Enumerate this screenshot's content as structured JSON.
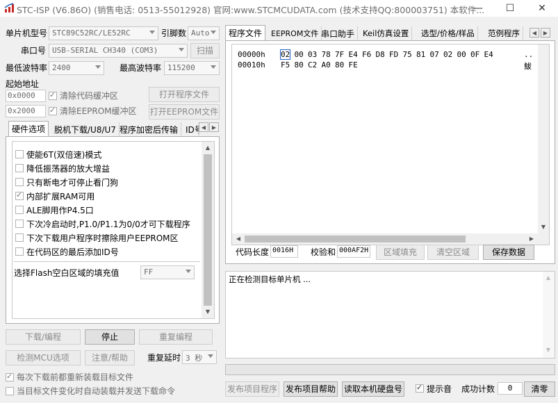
{
  "window": {
    "title": "STC-ISP (V6.86O) (销售电话: 0513-55012928) 官网:www.STCMCUDATA.com  (技术支持QQ:800003751) 本软件...",
    "min": "—",
    "max": "☐",
    "close": "✕"
  },
  "left": {
    "mcu_label": "单片机型号",
    "mcu_value": "STC89C52RC/LE52RC",
    "pins_label": "引脚数",
    "pins_value": "Auto",
    "port_label": "串口号",
    "port_value": "USB-SERIAL CH340 (COM3)",
    "scan": "扫描",
    "min_baud_label": "最低波特率",
    "min_baud_value": "2400",
    "max_baud_label": "最高波特率",
    "max_baud_value": "115200",
    "start_addr_label": "起始地址",
    "addr1": "0x0000",
    "clear_code": "清除代码缓冲区",
    "open_prog": "打开程序文件",
    "addr2": "0x2000",
    "clear_eeprom": "清除EEPROM缓冲区",
    "open_eeprom": "打开EEPROM文件",
    "tabs": [
      "硬件选项",
      "脱机下载/U8/U7",
      "程序加密后传输",
      "ID号"
    ],
    "options": [
      {
        "label": "使能6T(双倍速)模式",
        "checked": false
      },
      {
        "label": "降低振荡器的放大增益",
        "checked": false
      },
      {
        "label": "只有断电才可停止看门狗",
        "checked": false
      },
      {
        "label": "内部扩展RAM可用",
        "checked": true
      },
      {
        "label": "ALE脚用作P4.5口",
        "checked": false
      },
      {
        "label": "下次冷启动时,P1.0/P1.1为0/0才可下载程序",
        "checked": false
      },
      {
        "label": "下次下载用户程序时擦除用户EEPROM区",
        "checked": false
      },
      {
        "label": "在代码区的最后添加ID号",
        "checked": false
      }
    ],
    "flash_fill_label": "选择Flash空白区域的填充值",
    "flash_fill_value": "FF",
    "download": "下载/编程",
    "stop": "停止",
    "reprogram": "重复编程",
    "detect_mcu": "检测MCU选项",
    "help": "注意/帮助",
    "repeat_delay_label": "重复延时",
    "repeat_delay_value": "3 秒",
    "reload_each": "每次下载前都重新装载目标文件",
    "auto_reload": "当目标文件变化时自动装载并发送下载命令"
  },
  "right": {
    "tabs": [
      "程序文件",
      "EEPROM文件",
      "串口助手",
      "Keil仿真设置",
      "选型/价格/样品",
      "范例程序"
    ],
    "hex_rows": [
      {
        "addr": "00000h",
        "bytes": [
          "02",
          "00",
          "03",
          "78",
          "7F",
          "E4",
          "F6",
          "D8",
          "FD",
          "75",
          "81",
          "07",
          "02",
          "00",
          "0F",
          "E4"
        ],
        "ascii": ".."
      },
      {
        "addr": "00010h",
        "bytes": [
          "F5",
          "80",
          "C2",
          "A0",
          "80",
          "FE"
        ],
        "ascii": "鮁"
      }
    ],
    "code_len_label": "代码长度",
    "code_len_value": "0016H",
    "checksum_label": "校验和",
    "checksum_value": "000AF2H",
    "fill_area": "区域填充",
    "clear_area": "清空区域",
    "save_data": "保存数据",
    "log_text": "正在检测目标单片机 ...",
    "publish": "发布项目程序",
    "publish_help": "发布项目帮助",
    "read_hdd": "读取本机硬盘号",
    "sound_label": "提示音",
    "sound_checked": true,
    "success_count_label": "成功计数",
    "success_count_value": "0",
    "clear": "清零"
  }
}
